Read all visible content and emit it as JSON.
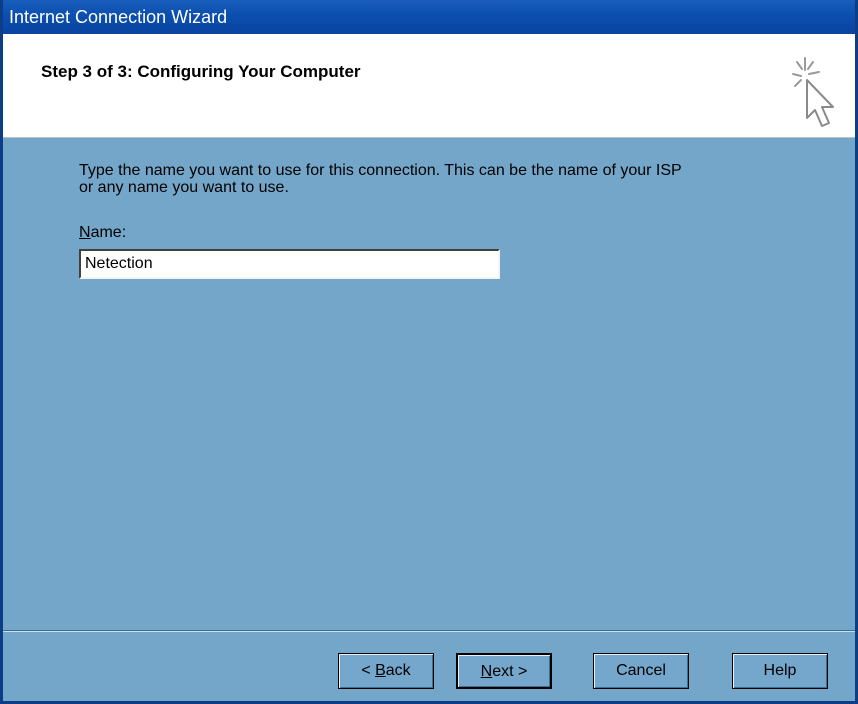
{
  "window": {
    "title": "Internet Connection Wizard"
  },
  "header": {
    "step_title": "Step 3 of 3: Configuring Your Computer"
  },
  "content": {
    "instruction_line1": "Type the name you want to use for this connection. This can be the name of your ISP",
    "instruction_line2": "or any name you want to use.",
    "name_label_accel": "N",
    "name_label_rest": "ame:",
    "name_value": "Netection"
  },
  "buttons": {
    "back_prefix": "< ",
    "back_accel": "B",
    "back_rest": "ack",
    "next_accel": "N",
    "next_rest": "ext >",
    "cancel": "Cancel",
    "help": "Help"
  }
}
